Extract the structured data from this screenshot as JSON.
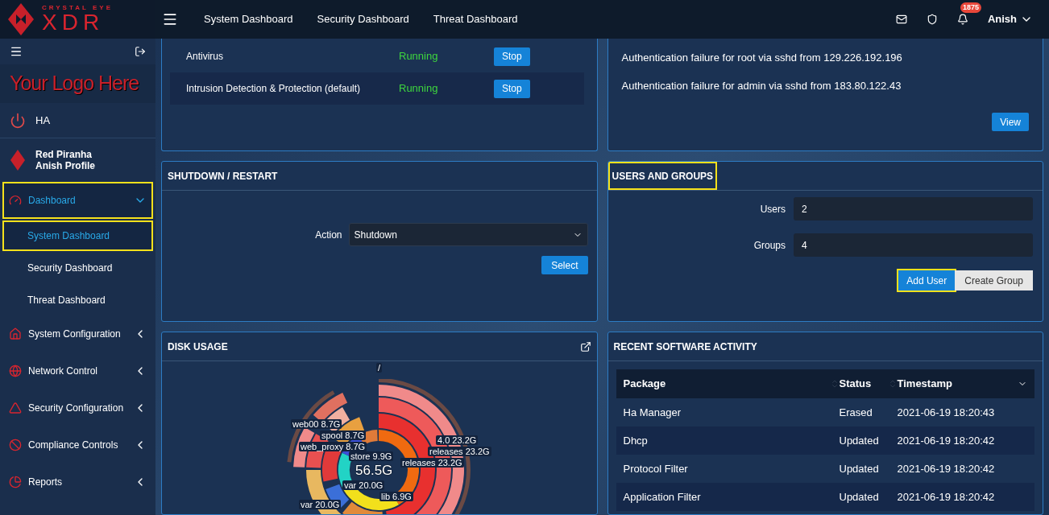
{
  "header": {
    "nav": [
      "System Dashboard",
      "Security Dashboard",
      "Threat Dashboard"
    ],
    "notification_count": "1875",
    "user": "Anish"
  },
  "sidebar": {
    "logo": {
      "brand_top": "CRYSTAL EYE",
      "brand_main": "XDR"
    },
    "custom_logo": "Your Logo Here",
    "ha": "HA",
    "profile": {
      "org": "Red Piranha",
      "name": "Anish Profile"
    },
    "items": [
      {
        "label": "Dashboard",
        "kind": "dashboard",
        "expanded": true,
        "selected": true,
        "highlighted": true,
        "children": [
          {
            "label": "System Dashboard",
            "selected": true,
            "highlighted": true
          },
          {
            "label": "Security Dashboard",
            "selected": false,
            "highlighted": false
          },
          {
            "label": "Threat Dashboard",
            "selected": false,
            "highlighted": false
          }
        ]
      },
      {
        "label": "System Configuration",
        "kind": "home",
        "expanded": false,
        "selected": false,
        "highlighted": false
      },
      {
        "label": "Network Control",
        "kind": "globe",
        "expanded": false,
        "selected": false,
        "highlighted": false
      },
      {
        "label": "Security Configuration",
        "kind": "warning",
        "expanded": false,
        "selected": false,
        "highlighted": false
      },
      {
        "label": "Compliance Controls",
        "kind": "ban",
        "expanded": false,
        "selected": false,
        "highlighted": false
      },
      {
        "label": "Reports",
        "kind": "pie",
        "expanded": false,
        "selected": false,
        "highlighted": false
      }
    ]
  },
  "services": {
    "rows": [
      {
        "name": "Antivirus",
        "status": "Running",
        "running": true,
        "action": "Stop"
      },
      {
        "name": "Intrusion Detection & Protection (default)",
        "status": "Running",
        "running": true,
        "action": "Stop"
      }
    ]
  },
  "notifications": {
    "items": [
      "Authentication failure for root via sshd from 129.226.192.196",
      "Authentication failure for admin via sshd from 183.80.122.43"
    ],
    "button": "View"
  },
  "shutdown": {
    "title": "SHUTDOWN / RESTART",
    "label": "Action",
    "value": "Shutdown",
    "button": "Select"
  },
  "users_groups": {
    "title": "USERS AND GROUPS",
    "highlighted": true,
    "fields": [
      {
        "label": "Users",
        "value": "2"
      },
      {
        "label": "Groups",
        "value": "4"
      }
    ],
    "buttons": [
      {
        "label": "Add User",
        "kind": "primary",
        "highlighted": true
      },
      {
        "label": "Create Group",
        "kind": "secondary",
        "highlighted": false
      }
    ]
  },
  "disk_usage": {
    "title": "DISK USAGE",
    "total": "56.5G",
    "labels": [
      "/",
      "web00 8.7G",
      "spool 8.7G",
      "web_proxy 8.7G",
      "store 9.9G",
      "4.0 23.2G",
      "releases 23.2G",
      "releases 23.2G",
      "var 20.0G",
      "lib 6.9G",
      "var 20.0G"
    ]
  },
  "software": {
    "title": "RECENT SOFTWARE ACTIVITY",
    "columns": [
      {
        "label": "Package",
        "sorted": false
      },
      {
        "label": "Status",
        "sorted": false
      },
      {
        "label": "Timestamp",
        "sorted": true
      }
    ],
    "rows": [
      [
        "Ha Manager",
        "Erased",
        "2021-06-19 18:20:43"
      ],
      [
        "Dhcp",
        "Updated",
        "2021-06-19 18:20:42"
      ],
      [
        "Protocol Filter",
        "Updated",
        "2021-06-19 18:20:42"
      ],
      [
        "Application Filter",
        "Updated",
        "2021-06-19 18:20:42"
      ]
    ]
  }
}
